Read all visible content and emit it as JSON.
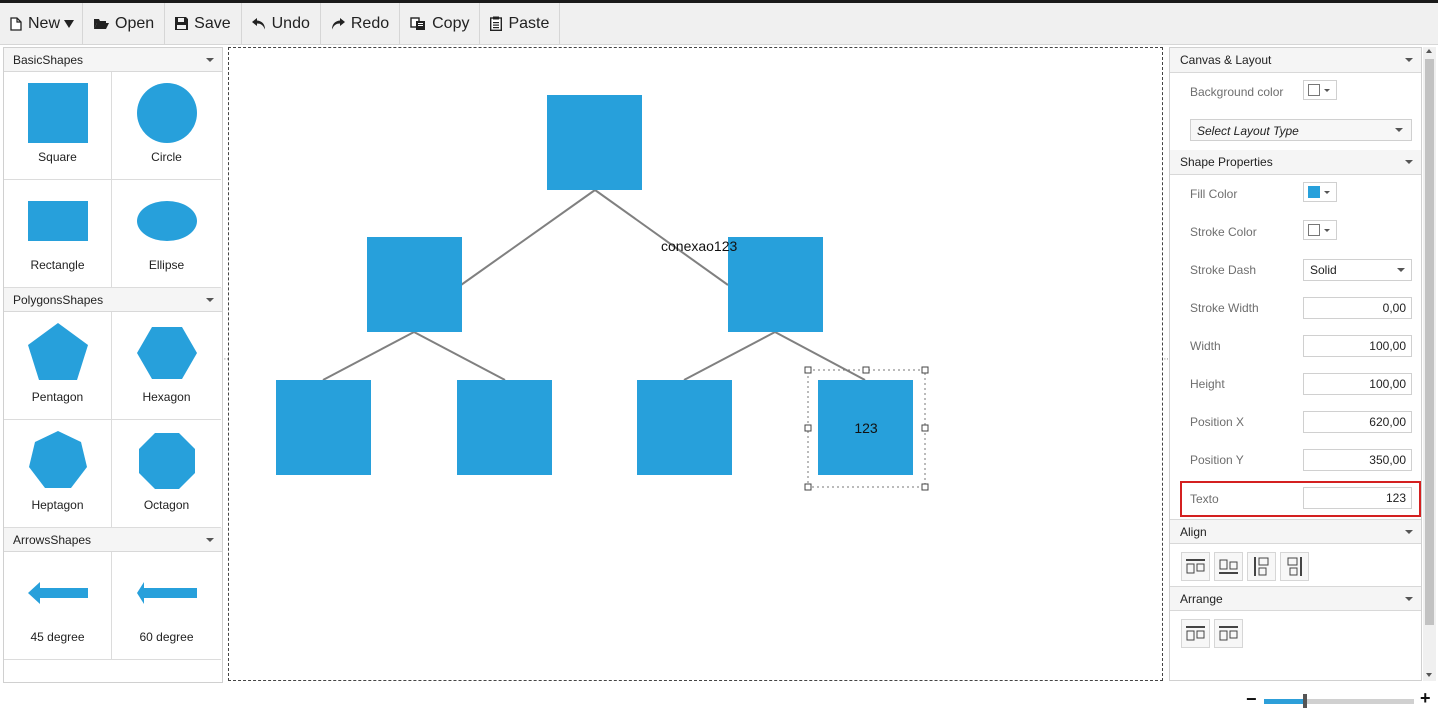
{
  "toolbar": {
    "new": "New",
    "open": "Open",
    "save": "Save",
    "undo": "Undo",
    "redo": "Redo",
    "copy": "Copy",
    "paste": "Paste"
  },
  "palette": {
    "basic": {
      "title": "BasicShapes",
      "items": [
        "Square",
        "Circle",
        "Rectangle",
        "Ellipse"
      ]
    },
    "polygons": {
      "title": "PolygonsShapes",
      "items": [
        "Pentagon",
        "Hexagon",
        "Heptagon",
        "Octagon"
      ]
    },
    "arrows": {
      "title": "ArrowsShapes",
      "items": [
        "45 degree",
        "60 degree"
      ]
    }
  },
  "canvas": {
    "connector_label": "conexao123",
    "selected_node_text": "123",
    "shape_color": "#27a0db",
    "connector_color": "#808080"
  },
  "properties": {
    "canvas_layout": {
      "title": "Canvas & Layout",
      "background_label": "Background color",
      "layout_placeholder": "Select Layout Type"
    },
    "shape": {
      "title": "Shape Properties",
      "fill_label": "Fill Color",
      "fill_color": "#27a0db",
      "stroke_label": "Stroke Color",
      "dash_label": "Stroke Dash",
      "dash_value": "Solid",
      "width_stroke_label": "Stroke Width",
      "width_stroke_value": "0,00",
      "width_label": "Width",
      "width_value": "100,00",
      "height_label": "Height",
      "height_value": "100,00",
      "posx_label": "Position X",
      "posx_value": "620,00",
      "posy_label": "Position Y",
      "posy_value": "350,00",
      "texto_label": "Texto",
      "texto_value": "123"
    },
    "align": {
      "title": "Align"
    },
    "arrange": {
      "title": "Arrange"
    }
  },
  "zoom": {
    "minus": "−",
    "plus": "+",
    "level": 0.27
  }
}
